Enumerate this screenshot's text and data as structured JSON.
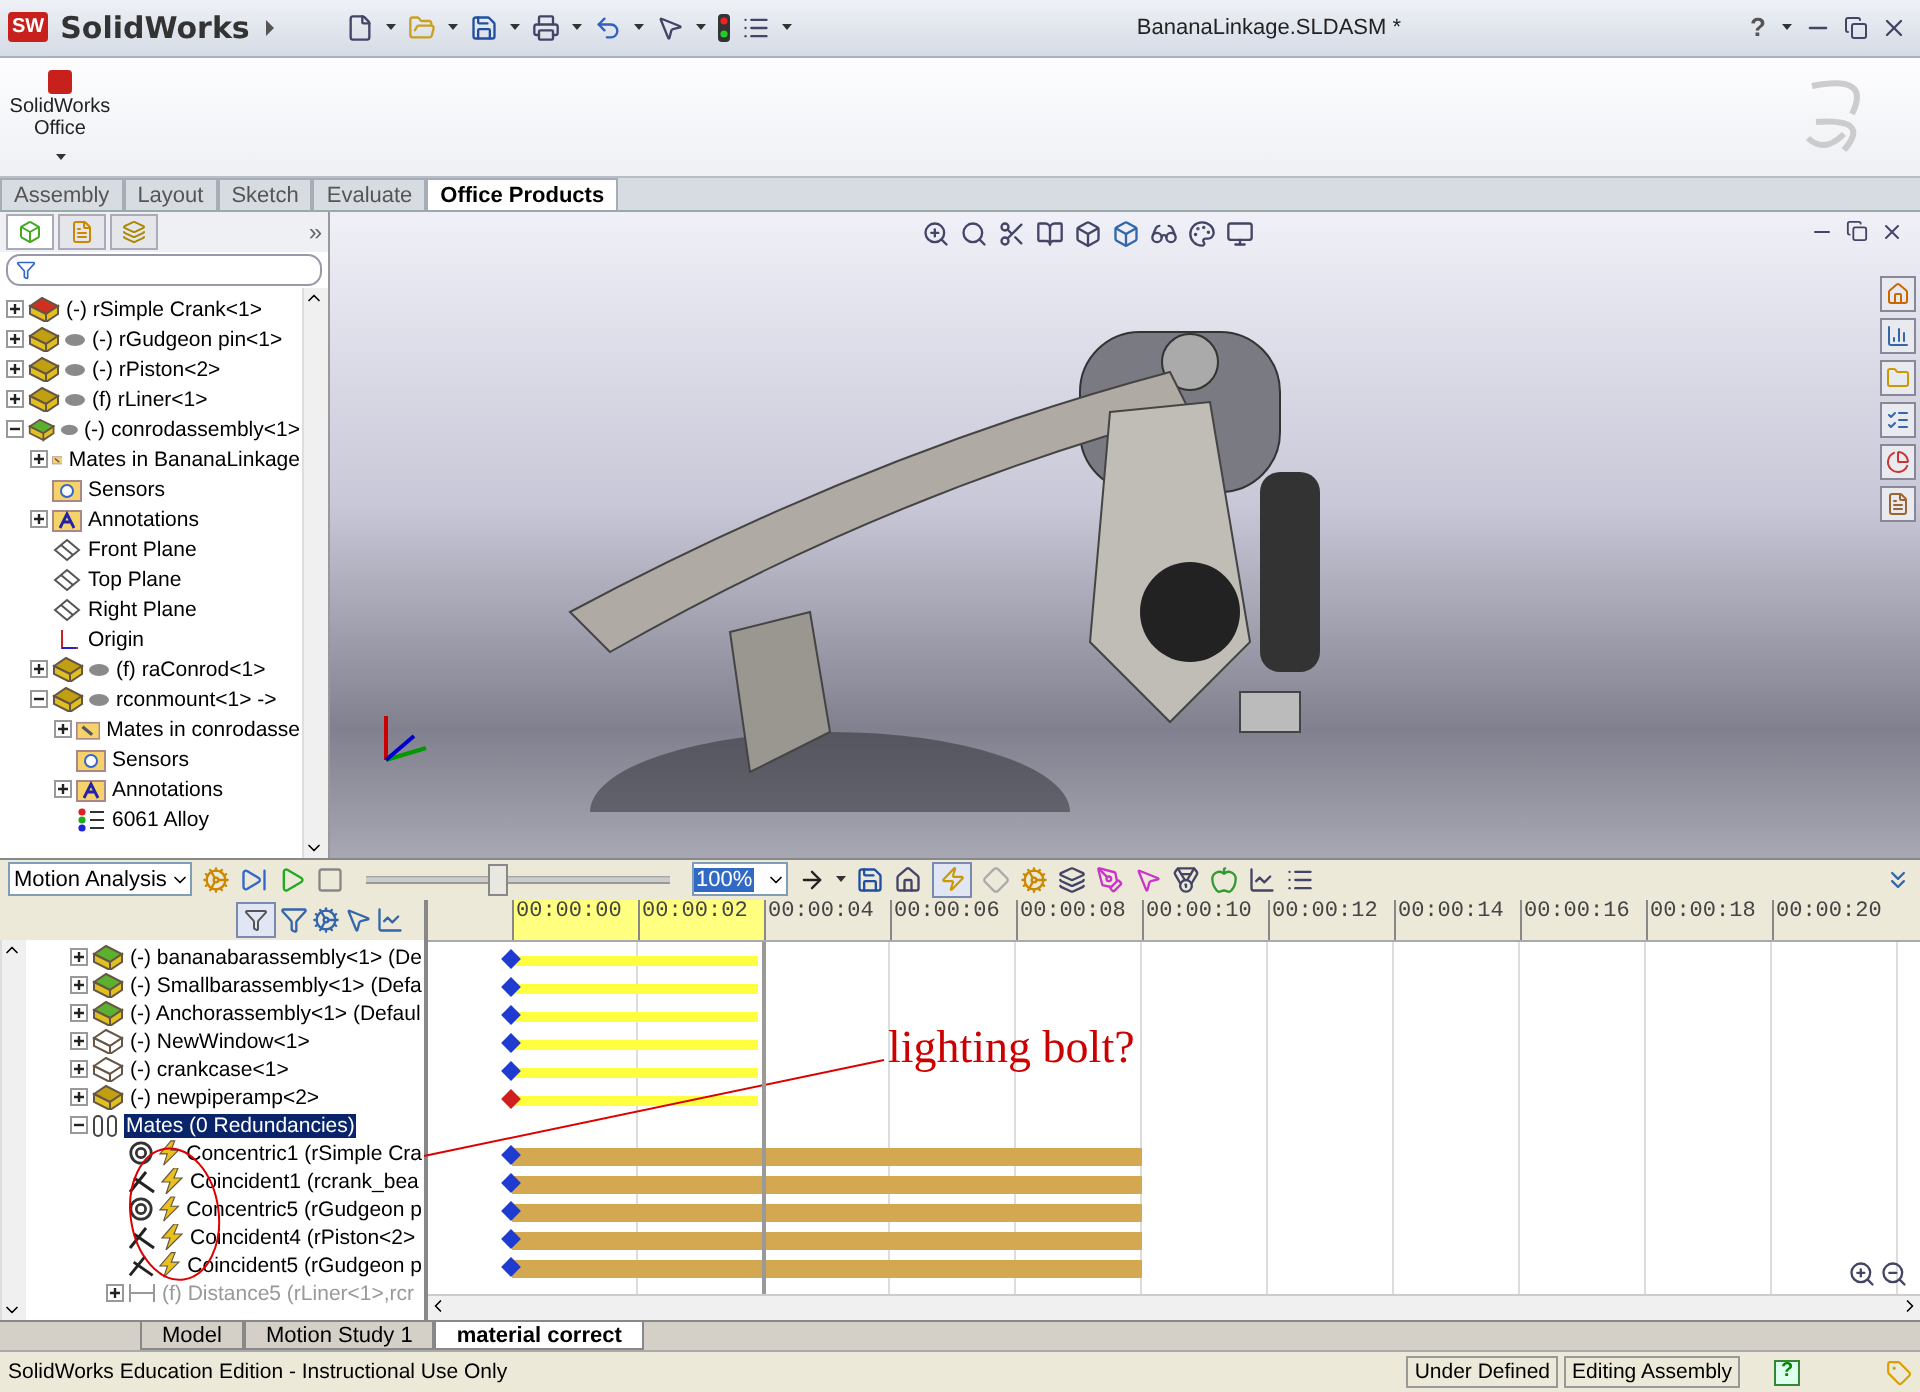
{
  "app": {
    "logo_mark": "SW",
    "name": "SolidWorks",
    "document_title": "BananaLinkage.SLDASM *",
    "help": "?"
  },
  "ribbon": {
    "buttons": [
      {
        "label": "SolidWorks Office"
      }
    ]
  },
  "command_tabs": [
    {
      "label": "Assembly",
      "selected": false
    },
    {
      "label": "Layout",
      "selected": false
    },
    {
      "label": "Sketch",
      "selected": false
    },
    {
      "label": "Evaluate",
      "selected": false
    },
    {
      "label": "Office Products",
      "selected": true
    }
  ],
  "feature_manager": {
    "more": "»",
    "tree": [
      {
        "label": "(-) rSimple Crank<1>",
        "kind": "assembly-rebuild",
        "expandable": true,
        "expanded": false
      },
      {
        "label": "(-) rGudgeon pin<1>",
        "kind": "part",
        "expandable": true,
        "expanded": false
      },
      {
        "label": "(-) rPiston<2>",
        "kind": "part",
        "expandable": true,
        "expanded": false
      },
      {
        "label": "(f) rLiner<1>",
        "kind": "part",
        "expandable": true,
        "expanded": false
      },
      {
        "label": "(-) conrodassembly<1>",
        "kind": "assembly",
        "expandable": true,
        "expanded": true,
        "children": [
          {
            "label": "Mates in BananaLinkage",
            "kind": "mates-folder",
            "expandable": true,
            "expanded": false
          },
          {
            "label": "Sensors",
            "kind": "sensors",
            "expandable": false
          },
          {
            "label": "Annotations",
            "kind": "annotations",
            "expandable": true,
            "expanded": false
          },
          {
            "label": "Front Plane",
            "kind": "plane",
            "expandable": false
          },
          {
            "label": "Top Plane",
            "kind": "plane",
            "expandable": false
          },
          {
            "label": "Right Plane",
            "kind": "plane",
            "expandable": false
          },
          {
            "label": "Origin",
            "kind": "origin",
            "expandable": false
          },
          {
            "label": "(f) raConrod<1>",
            "kind": "part",
            "expandable": true,
            "expanded": false
          },
          {
            "label": "rconmount<1> ->",
            "kind": "part",
            "expandable": true,
            "expanded": true,
            "children": [
              {
                "label": "Mates in conrodasse",
                "kind": "mates-folder",
                "expandable": true,
                "expanded": false
              },
              {
                "label": "Sensors",
                "kind": "sensors",
                "expandable": false
              },
              {
                "label": "Annotations",
                "kind": "annotations",
                "expandable": true,
                "expanded": false
              },
              {
                "label": "6061 Alloy",
                "kind": "material",
                "expandable": false
              }
            ]
          }
        ]
      }
    ]
  },
  "motion_manager": {
    "study_type": "Motion Analysis",
    "slider": {
      "level": 0.43
    },
    "zoom": "100%",
    "timeline": {
      "ticks": [
        {
          "label": "00:00:00",
          "highlighted": true
        },
        {
          "label": "00:00:02",
          "highlighted": true
        },
        {
          "label": "00:00:04",
          "highlighted": false
        },
        {
          "label": "00:00:06",
          "highlighted": false
        },
        {
          "label": "00:00:08",
          "highlighted": false
        },
        {
          "label": "00:00:10",
          "highlighted": false
        },
        {
          "label": "00:00:12",
          "highlighted": false
        },
        {
          "label": "00:00:14",
          "highlighted": false
        },
        {
          "label": "00:00:16",
          "highlighted": false
        },
        {
          "label": "00:00:18",
          "highlighted": false
        },
        {
          "label": "00:00:20",
          "highlighted": false
        }
      ]
    },
    "rows": [
      {
        "label": "(-) bananabarassembly<1> (De",
        "kind": "assembly",
        "expanded": false,
        "selected": false,
        "disabled": false,
        "color": "#1f3bd0"
      },
      {
        "label": "(-) Smallbarassembly<1> (Defa",
        "kind": "assembly",
        "expanded": false,
        "selected": false,
        "disabled": false,
        "color": "#1f3bd0"
      },
      {
        "label": "(-) Anchorassembly<1> (Defaul",
        "kind": "assembly",
        "expanded": false,
        "selected": false,
        "disabled": false,
        "color": "#1f3bd0"
      },
      {
        "label": "(-) NewWindow<1>",
        "kind": "outline-part",
        "expanded": false,
        "selected": false,
        "disabled": false,
        "color": "#1f3bd0"
      },
      {
        "label": "(-) crankcase<1>",
        "kind": "outline-part",
        "expanded": false,
        "selected": false,
        "disabled": false,
        "color": "#1f3bd0"
      },
      {
        "label": "(-) newpiperamp<2>",
        "kind": "part",
        "expanded": false,
        "selected": false,
        "disabled": false,
        "color": "#d01f1f"
      },
      {
        "label": "Mates (0 Redundancies)",
        "kind": "mates",
        "expanded": true,
        "selected": true,
        "disabled": false,
        "children": [
          {
            "label": "Concentric1 (rSimple Cra",
            "kind": "concentric",
            "selected": false,
            "disabled": false,
            "color": "#1f3bd0"
          },
          {
            "label": "Coincident1 (rcrank_bea",
            "kind": "coincident",
            "selected": false,
            "disabled": false,
            "color": "#1f3bd0"
          },
          {
            "label": "Concentric5 (rGudgeon p",
            "kind": "concentric",
            "selected": false,
            "disabled": false,
            "color": "#1f3bd0"
          },
          {
            "label": "Coincident4 (rPiston<2>",
            "kind": "coincident",
            "selected": false,
            "disabled": false,
            "color": "#1f3bd0"
          },
          {
            "label": "Coincident5 (rGudgeon p",
            "kind": "coincident",
            "selected": false,
            "disabled": false,
            "color": "#1f3bd0"
          },
          {
            "label": "(f) Distance5 (rLiner<1>,rcr",
            "kind": "distance",
            "selected": false,
            "disabled": true
          }
        ]
      }
    ]
  },
  "study_tabs": [
    {
      "label": "Model",
      "selected": false
    },
    {
      "label": "Motion Study 1",
      "selected": false
    },
    {
      "label": "material correct",
      "selected": true
    }
  ],
  "status_bar": {
    "edition": "SolidWorks Education Edition - Instructional Use Only",
    "fields": [
      "Under Defined",
      "Editing Assembly"
    ],
    "help": "?"
  },
  "annotation": {
    "text": "lighting bolt?"
  }
}
